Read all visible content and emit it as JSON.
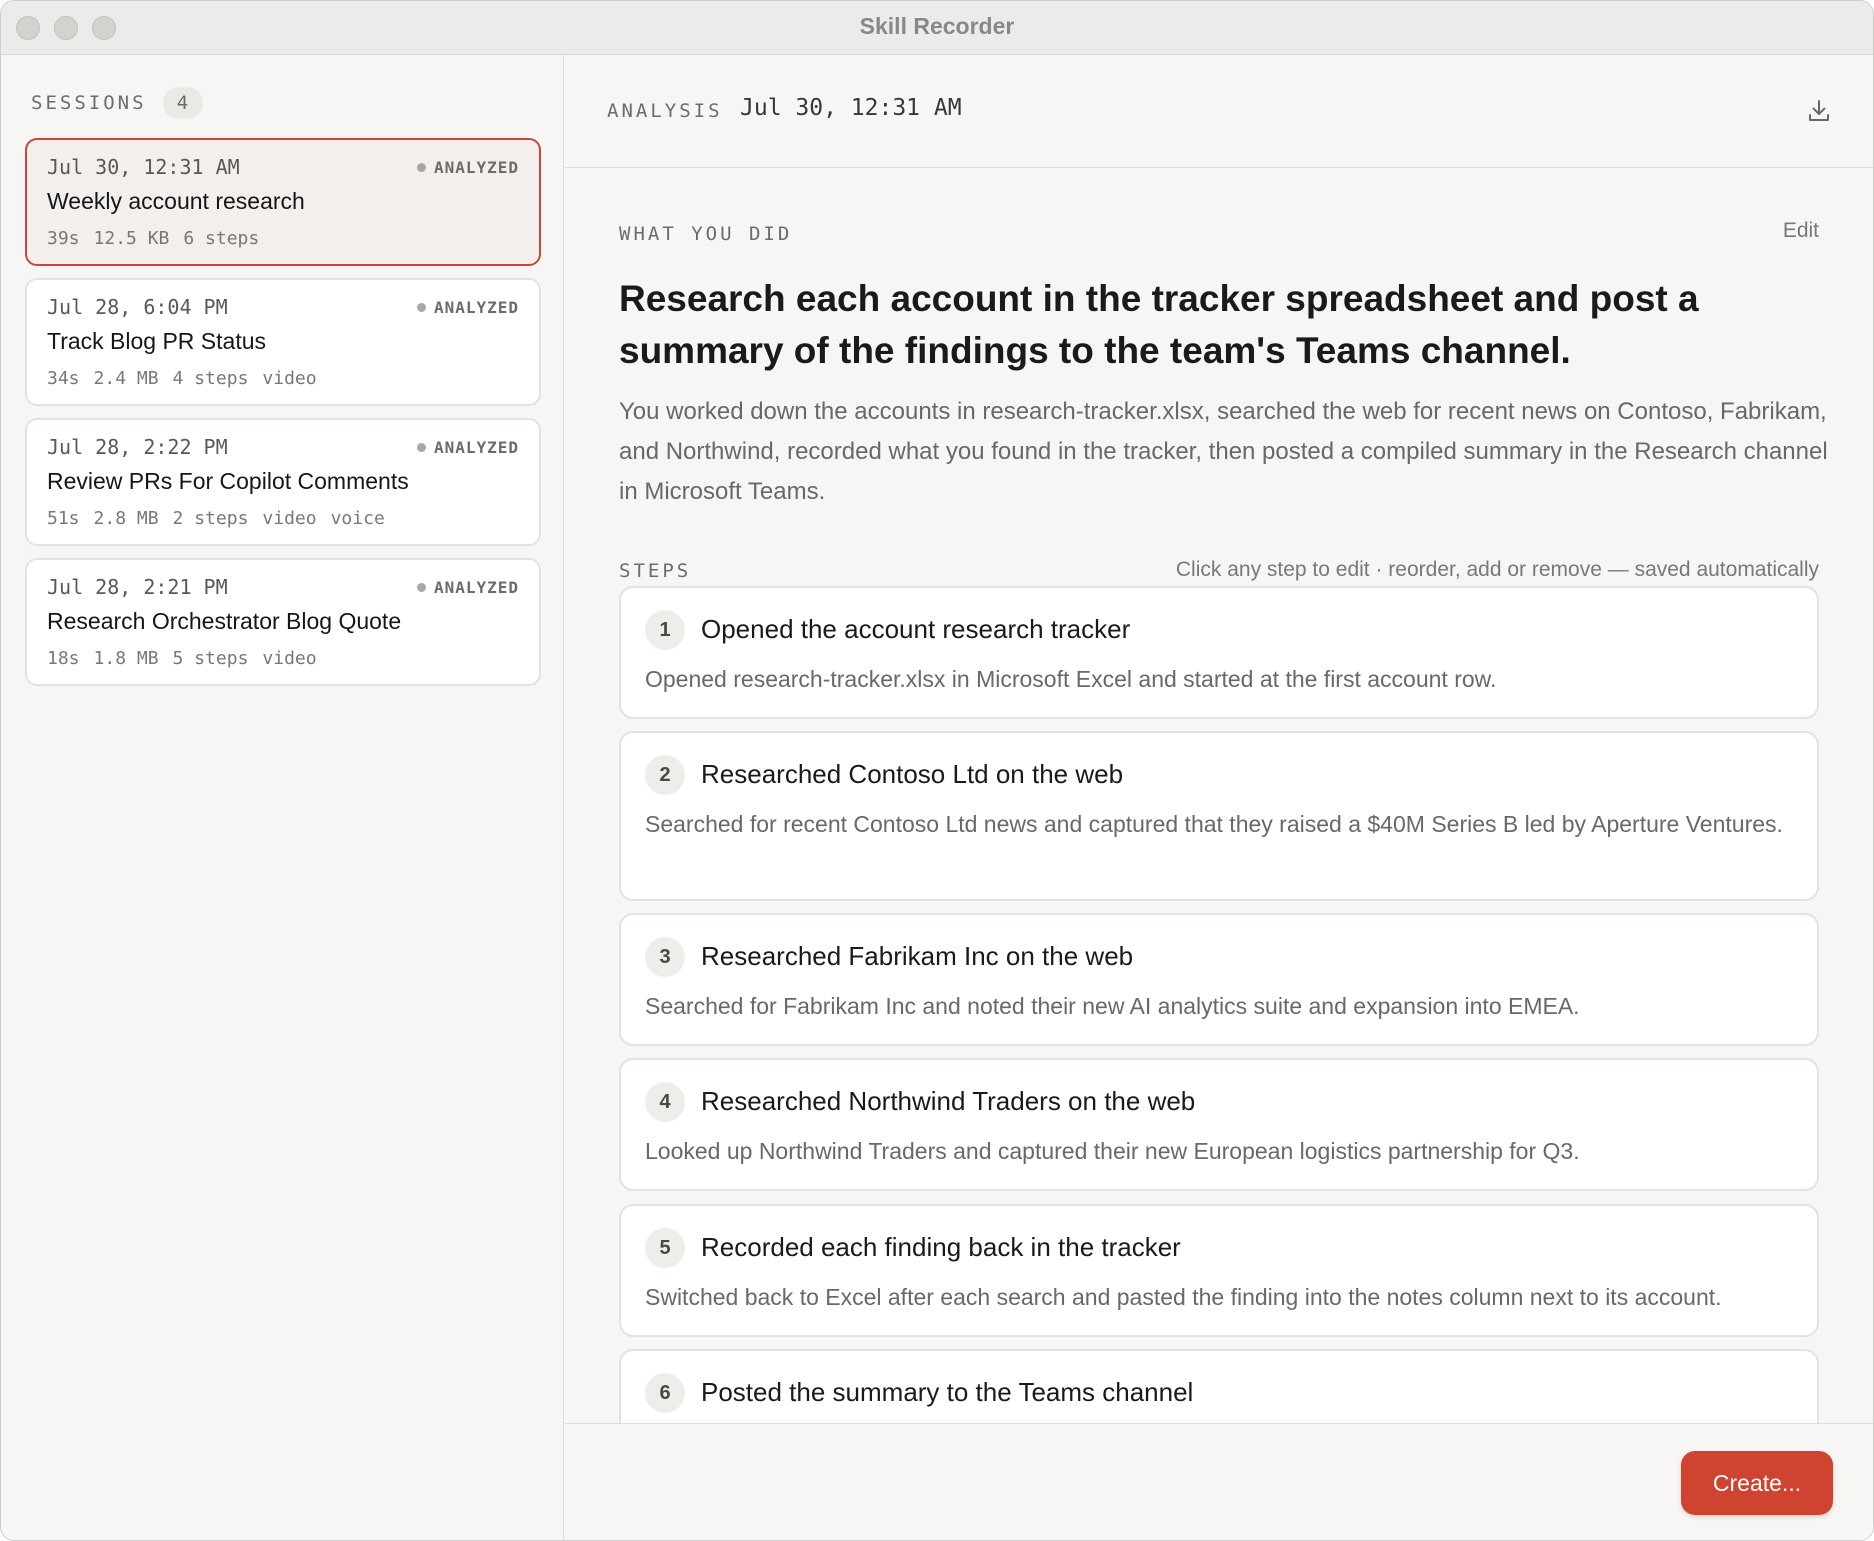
{
  "window": {
    "title": "Skill Recorder"
  },
  "sidebar": {
    "label": "SESSIONS",
    "count": "4",
    "sessions": [
      {
        "date": "Jul 30, 12:31 AM",
        "status": "ANALYZED",
        "title": "Weekly account research",
        "meta": [
          "39s",
          "12.5 KB",
          "6 steps"
        ],
        "active": true
      },
      {
        "date": "Jul 28, 6:04 PM",
        "status": "ANALYZED",
        "title": "Track Blog PR Status",
        "meta": [
          "34s",
          "2.4 MB",
          "4 steps",
          "video"
        ],
        "active": false
      },
      {
        "date": "Jul 28, 2:22 PM",
        "status": "ANALYZED",
        "title": "Review PRs For Copilot Comments",
        "meta": [
          "51s",
          "2.8 MB",
          "2 steps",
          "video",
          "voice"
        ],
        "active": false
      },
      {
        "date": "Jul 28, 2:21 PM",
        "status": "ANALYZED",
        "title": "Research Orchestrator Blog Quote",
        "meta": [
          "18s",
          "1.8 MB",
          "5 steps",
          "video"
        ],
        "active": false
      }
    ]
  },
  "header": {
    "label": "ANALYSIS",
    "date": "Jul 30, 12:31 AM",
    "download_icon": "download-icon"
  },
  "summary": {
    "label": "WHAT YOU DID",
    "edit": "Edit",
    "title": "Research each account in the tracker spreadsheet and post a summary of the findings to the team's Teams channel.",
    "description": "You worked down the accounts in research-tracker.xlsx, searched the web for recent news on Contoso, Fabrikam, and Northwind, recorded what you found in the tracker, then posted a compiled summary in the Research channel in Microsoft Teams."
  },
  "steps": {
    "label": "STEPS",
    "hint": "Click any step to edit · reorder, add or remove — saved automatically",
    "items": [
      {
        "num": "1",
        "title": "Opened the account research tracker",
        "desc": "Opened research-tracker.xlsx in Microsoft Excel and started at the first account row."
      },
      {
        "num": "2",
        "title": "Researched Contoso Ltd on the web",
        "desc": "Searched for recent Contoso Ltd news and captured that they raised a $40M Series B led by Aperture Ventures."
      },
      {
        "num": "3",
        "title": "Researched Fabrikam Inc on the web",
        "desc": "Searched for Fabrikam Inc and noted their new AI analytics suite and expansion into EMEA."
      },
      {
        "num": "4",
        "title": "Researched Northwind Traders on the web",
        "desc": "Looked up Northwind Traders and captured their new European logistics partnership for Q3."
      },
      {
        "num": "5",
        "title": "Recorded each finding back in the tracker",
        "desc": "Switched back to Excel after each search and pasted the finding into the notes column next to its account."
      },
      {
        "num": "6",
        "title": "Posted the summary to the Teams channel",
        "desc": ""
      }
    ]
  },
  "footer": {
    "create_label": "Create..."
  },
  "colors": {
    "accent": "#cf4431",
    "active_border": "#c8463a",
    "background": "#f7f6f4"
  }
}
